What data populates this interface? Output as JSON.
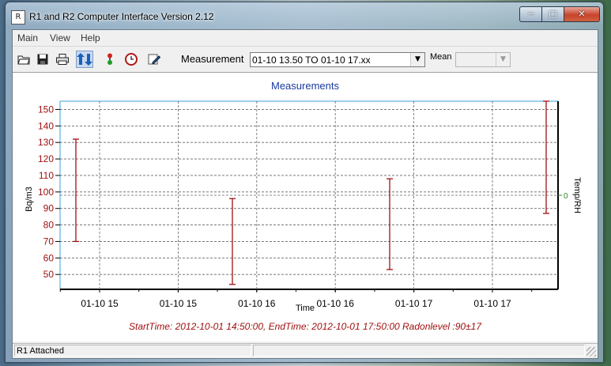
{
  "window": {
    "title": "R1 and R2  Computer Interface Version 2.12"
  },
  "menu": [
    "Main",
    "View",
    "Help"
  ],
  "toolbar": {
    "icons": [
      "open-folder-icon",
      "save-icon",
      "print-icon",
      "transfer-icon",
      "traffic-light-icon",
      "clock-icon",
      "edit-icon"
    ],
    "measurement_label": "Measurement",
    "measurement_value": "01-10 13.50 TO 01-10 17.xx",
    "mean_label": "Mean",
    "mean_value": ""
  },
  "chart_data": {
    "type": "errorbar",
    "title": "Measurements",
    "xlabel": "Time",
    "ylabel": "Bq/m3",
    "y2label": "Temp/RH",
    "y2_ticks": [
      "0"
    ],
    "ylim": [
      41,
      155
    ],
    "yticks": [
      50,
      60,
      70,
      80,
      90,
      100,
      110,
      120,
      130,
      140,
      150
    ],
    "xticks": [
      "01-10 15",
      "01-10 15",
      "01-10 16",
      "01-10 16",
      "01-10 17",
      "01-10 17"
    ],
    "series": [
      {
        "points": [
          {
            "low": 70,
            "high": 132
          },
          {
            "low": 44,
            "high": 96
          },
          {
            "low": 53,
            "high": 108
          },
          {
            "low": 87,
            "high": 155
          }
        ]
      }
    ],
    "reference_line": 98,
    "colors": {
      "bars": "#a01010",
      "axis_text": "#a01010",
      "title": "#1a3aa0",
      "y2": "#2a8a2a"
    },
    "footer": "StartTime: 2012-10-01 14:50:00, EndTime: 2012-10-01 17:50:00 Radonlevel :90±17"
  },
  "status": {
    "left": "R1 Attached",
    "right": ""
  }
}
